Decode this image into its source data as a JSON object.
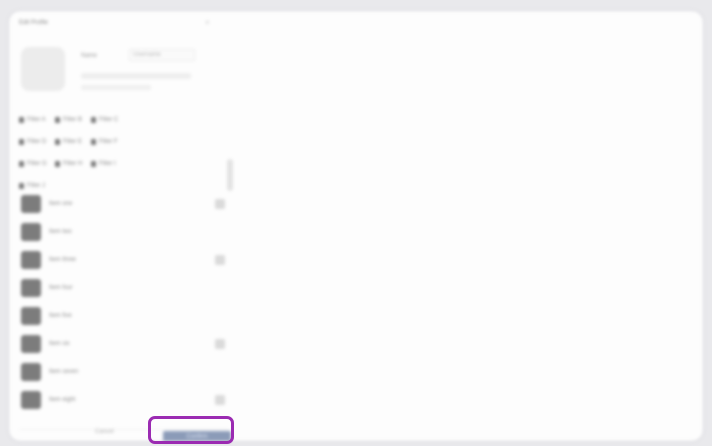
{
  "window": {
    "title": "Edit Profile",
    "close_label": "×"
  },
  "profile": {
    "name_label": "Name",
    "name_value": "Username"
  },
  "filters": [
    [
      {
        "label": "Filter A"
      },
      {
        "label": "Filter B"
      },
      {
        "label": "Filter C"
      }
    ],
    [
      {
        "label": "Filter D"
      },
      {
        "label": "Filter E"
      },
      {
        "label": "Filter F"
      }
    ],
    [
      {
        "label": "Filter G"
      },
      {
        "label": "Filter H"
      },
      {
        "label": "Filter I"
      }
    ],
    [
      {
        "label": "Filter J"
      }
    ]
  ],
  "list": [
    {
      "label": "Item one",
      "badge": true
    },
    {
      "label": "Item two",
      "badge": false
    },
    {
      "label": "Item three",
      "badge": true
    },
    {
      "label": "Item four",
      "badge": false
    },
    {
      "label": "Item five",
      "badge": false
    },
    {
      "label": "Item six",
      "badge": true
    },
    {
      "label": "Item seven",
      "badge": false
    },
    {
      "label": "Item eight",
      "badge": true
    }
  ],
  "footer": {
    "cancel_label": "Cancel",
    "confirm_label": "Confirm"
  },
  "colors": {
    "highlight": "#9b2bb2",
    "confirm": "#8b9bb8"
  }
}
